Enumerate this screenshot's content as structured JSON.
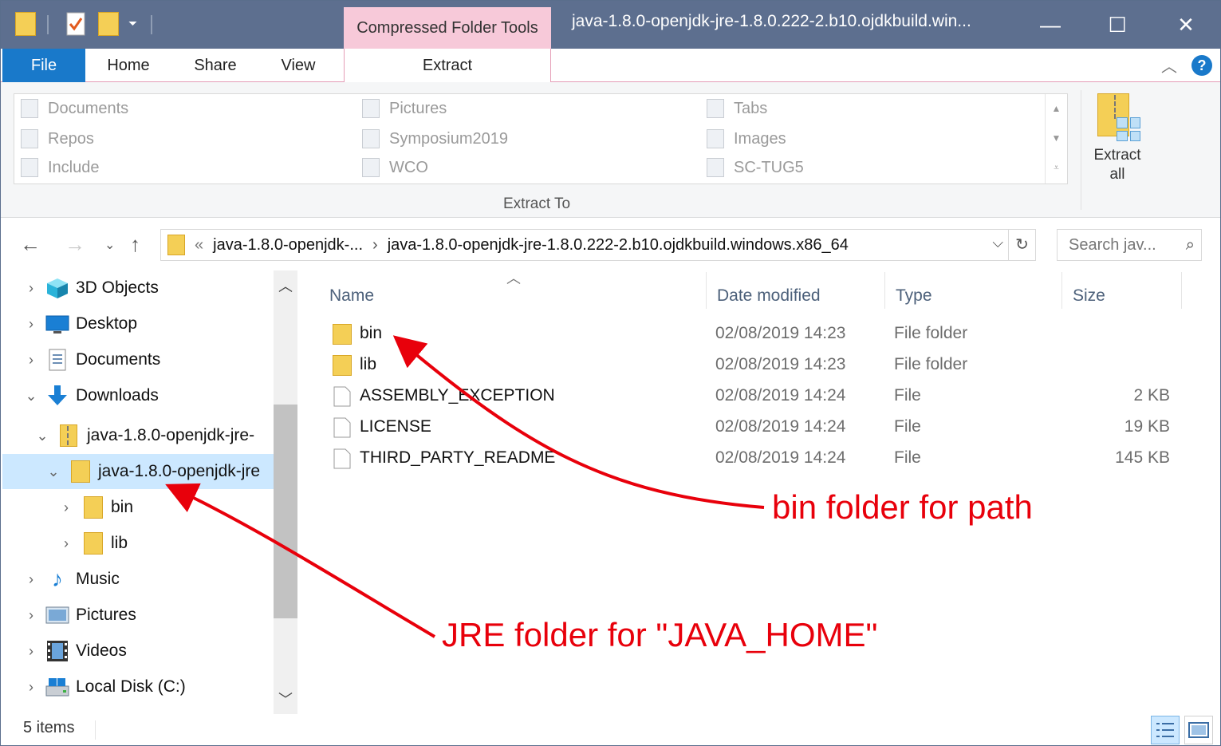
{
  "window": {
    "title": "java-1.8.0-openjdk-jre-1.8.0.222-2.b10.ojdkbuild.win...",
    "contextual_tab_group": "Compressed Folder Tools",
    "controls": {
      "minimize": "—",
      "maximize": "☐",
      "close": "✕"
    }
  },
  "ribbon": {
    "tabs": [
      "File",
      "Home",
      "Share",
      "View",
      "Extract"
    ],
    "extract_to": {
      "destinations": [
        "Documents",
        "Pictures",
        "Tabs",
        "Repos",
        "Symposium2019",
        "Images",
        "Include",
        "WCO",
        "SC-TUG5"
      ],
      "group_label": "Extract To"
    },
    "extract_all_label_line1": "Extract",
    "extract_all_label_line2": "all",
    "help": "?"
  },
  "address_bar": {
    "overflow": "«",
    "segments": [
      "java-1.8.0-openjdk-...",
      "java-1.8.0-openjdk-jre-1.8.0.222-2.b10.ojdkbuild.windows.x86_64"
    ],
    "separator": "›",
    "search_placeholder": "Search jav..."
  },
  "nav_pane": {
    "items": [
      {
        "label": "3D Objects",
        "icon": "3d-objects-icon"
      },
      {
        "label": "Desktop",
        "icon": "desktop-icon"
      },
      {
        "label": "Documents",
        "icon": "documents-icon"
      },
      {
        "label": "Downloads",
        "icon": "downloads-icon"
      },
      {
        "label": "java-1.8.0-openjdk-jre-",
        "icon": "zip-folder-icon"
      },
      {
        "label": "java-1.8.0-openjdk-jre",
        "icon": "folder-icon",
        "selected": true
      },
      {
        "label": "bin",
        "icon": "folder-icon"
      },
      {
        "label": "lib",
        "icon": "folder-icon"
      },
      {
        "label": "Music",
        "icon": "music-icon"
      },
      {
        "label": "Pictures",
        "icon": "pictures-icon"
      },
      {
        "label": "Videos",
        "icon": "videos-icon"
      },
      {
        "label": "Local Disk (C:)",
        "icon": "local-disk-icon"
      }
    ]
  },
  "file_list": {
    "columns": [
      "Name",
      "Date modified",
      "Type",
      "Size"
    ],
    "rows": [
      {
        "name": "bin",
        "date": "02/08/2019 14:23",
        "type": "File folder",
        "size": "",
        "icon": "folder-icon"
      },
      {
        "name": "lib",
        "date": "02/08/2019 14:23",
        "type": "File folder",
        "size": "",
        "icon": "folder-icon"
      },
      {
        "name": "ASSEMBLY_EXCEPTION",
        "date": "02/08/2019 14:24",
        "type": "File",
        "size": "2 KB",
        "icon": "file-icon"
      },
      {
        "name": "LICENSE",
        "date": "02/08/2019 14:24",
        "type": "File",
        "size": "19 KB",
        "icon": "file-icon"
      },
      {
        "name": "THIRD_PARTY_README",
        "date": "02/08/2019 14:24",
        "type": "File",
        "size": "145 KB",
        "icon": "file-icon"
      }
    ]
  },
  "status_bar": {
    "item_count": "5 items"
  },
  "annotations": {
    "bin_label": "bin folder for path",
    "jre_label": "JRE folder for \"JAVA_HOME\"",
    "color": "#e8000b"
  },
  "colors": {
    "file_tab": "#1979ca",
    "titlebar": "#5d6f8f",
    "contextual_tab": "#f7c9d9",
    "selection": "#cce8ff",
    "folder": "#f4cf56"
  }
}
